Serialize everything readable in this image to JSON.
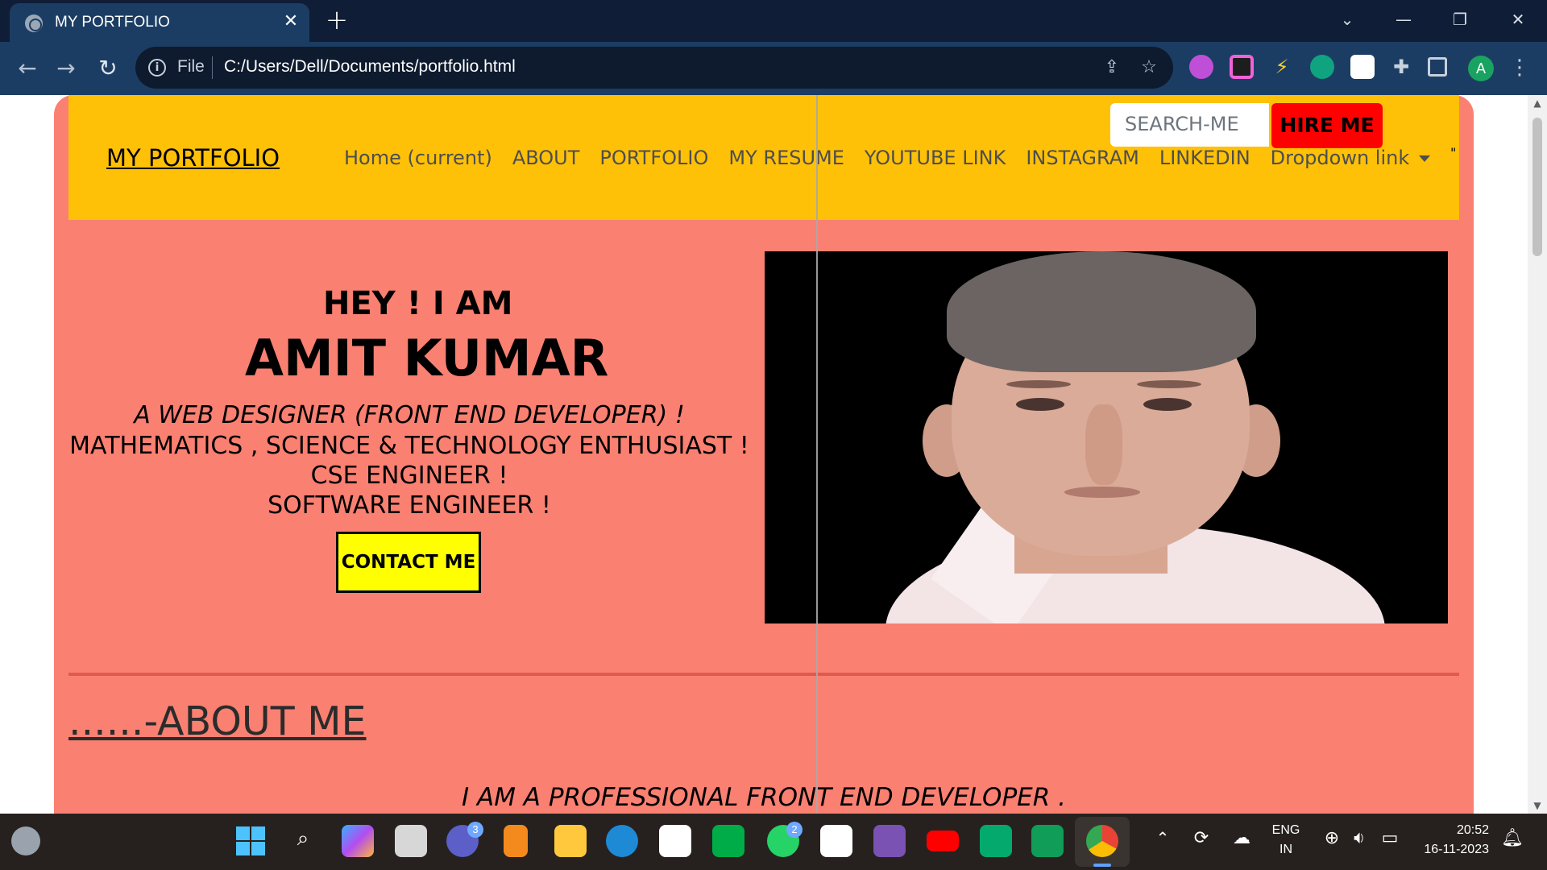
{
  "browser": {
    "tab_title": "MY PORTFOLIO",
    "tab_close": "✕",
    "new_tab": "+",
    "file_label": "File",
    "url": "C:/Users/Dell/Documents/portfolio.html",
    "profile_initial": "A"
  },
  "navbar": {
    "brand": "MY PORTFOLIO",
    "links": [
      "Home (current)",
      "ABOUT",
      "PORTFOLIO",
      "MY RESUME",
      "YOUTUBE LINK",
      "INSTAGRAM",
      "LINKEDIN",
      "Dropdown link"
    ],
    "search_placeholder": "SEARCH-ME",
    "hire_button": "HIRE ME",
    "quote_char": "\""
  },
  "hero": {
    "greeting": "HEY ! I AM",
    "name": "AMIT KUMAR",
    "role": "A WEB DESIGNER (FRONT END DEVELOPER) !",
    "line2": "MATHEMATICS , SCIENCE & TECHNOLOGY ENTHUSIAST !",
    "line3": "CSE ENGINEER !",
    "line4": "SOFTWARE ENGINEER !",
    "contact_button": "CONTACT ME"
  },
  "about": {
    "heading": "......-ABOUT ME",
    "tagline": "I AM A PROFESSIONAL FRONT END DEVELOPER ."
  },
  "taskbar": {
    "teams_badge": "3",
    "whatsapp_badge": "2",
    "lang_line1": "ENG",
    "lang_line2": "IN",
    "time": "20:52",
    "date": "16-11-2023"
  },
  "colors": {
    "page_bg": "#fa8072",
    "navbar_bg": "#ffc107",
    "hire_bg": "#ff0000",
    "contact_bg": "#ffff00"
  }
}
